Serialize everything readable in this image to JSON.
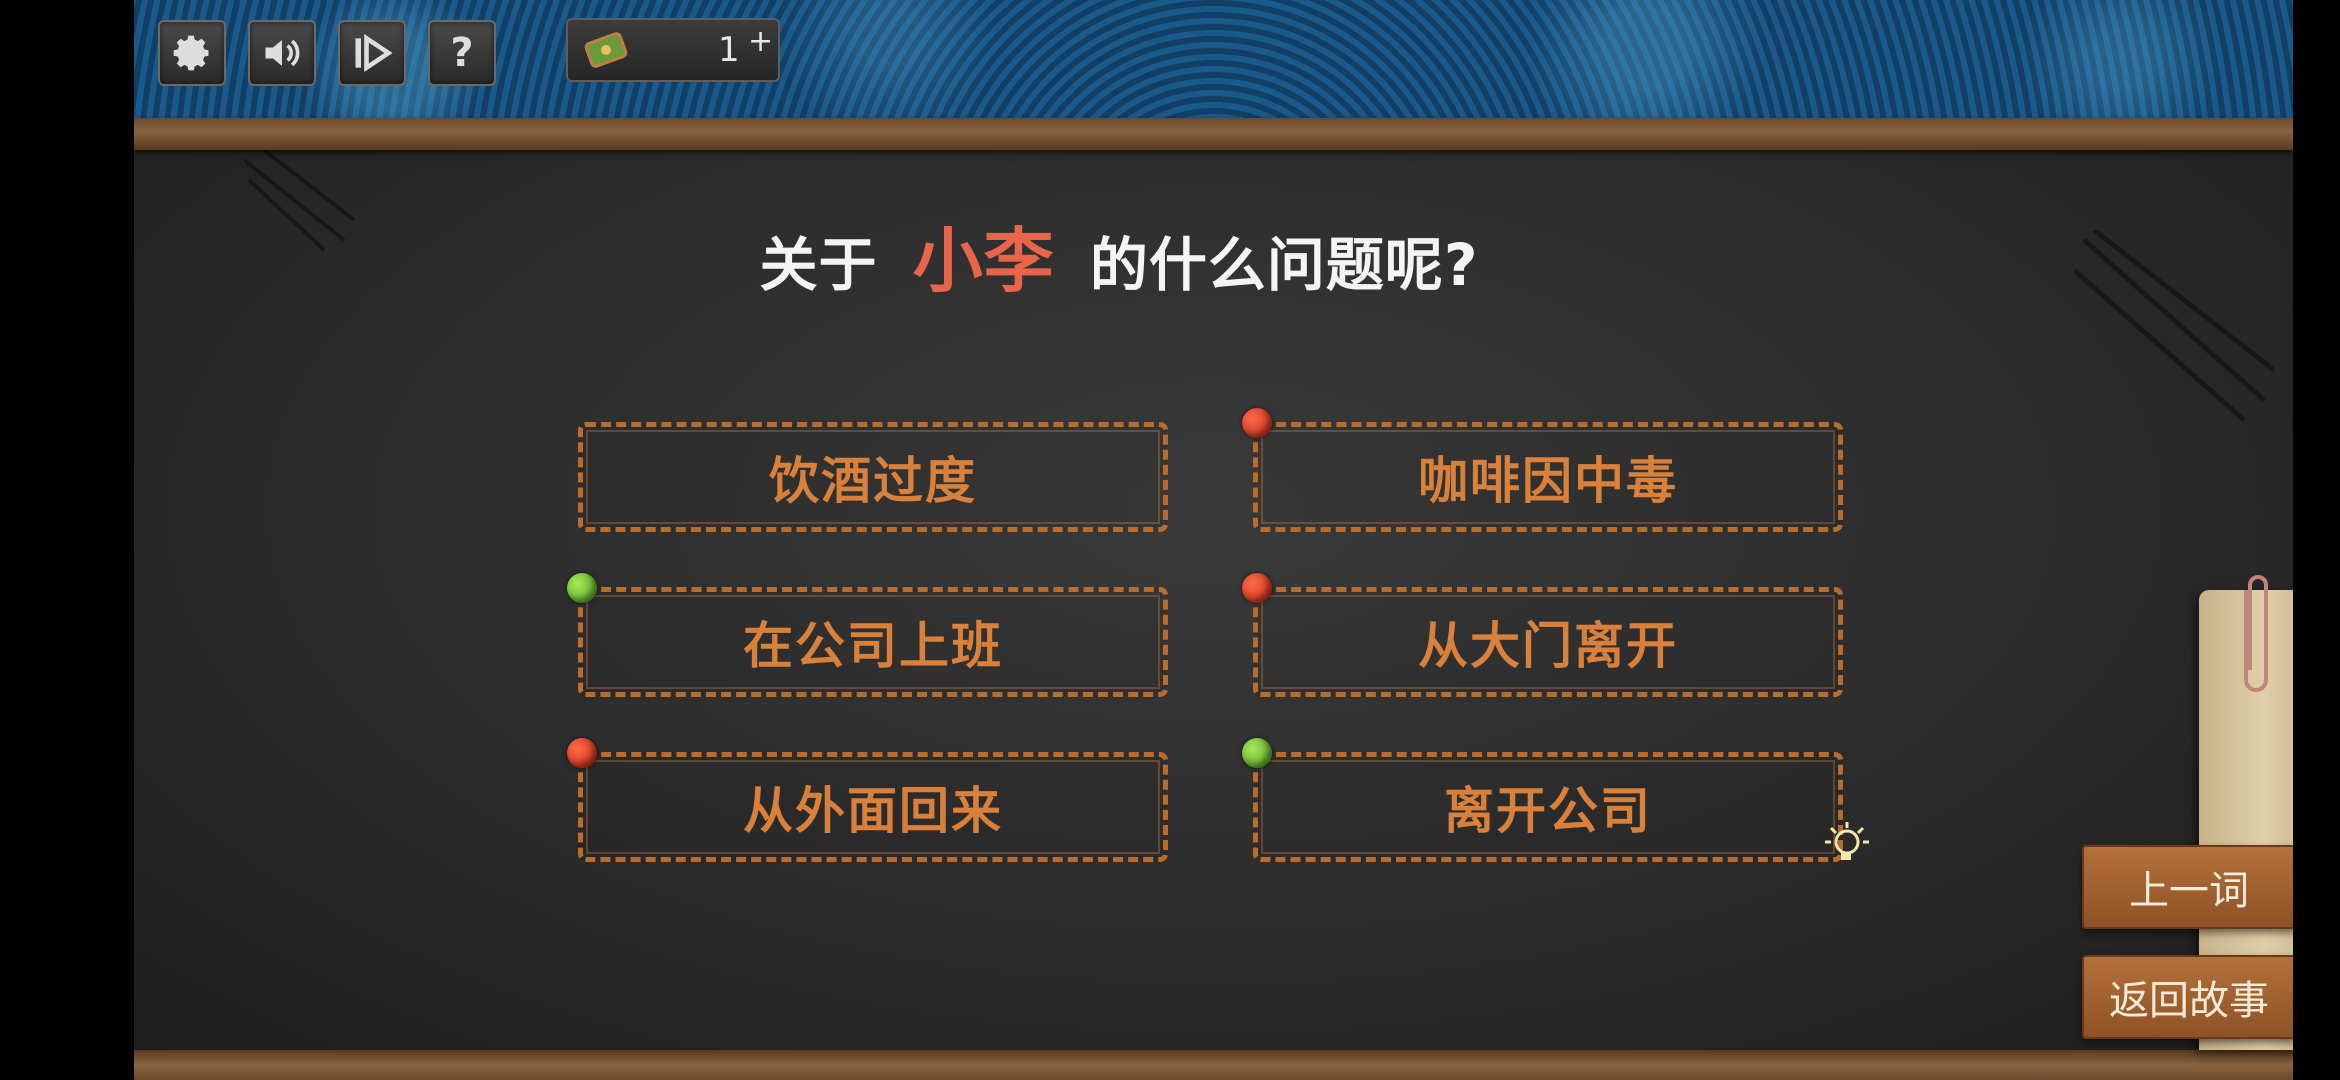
{
  "toolbar": {
    "settings_icon": "gear-icon",
    "sound_icon": "speaker-icon",
    "skip_icon": "skip-play-icon",
    "help_label": "?",
    "hint_count": "1",
    "hint_plus": "+"
  },
  "question": {
    "prefix": "关于",
    "name": "小李",
    "suffix": "的什么问题呢?"
  },
  "options": [
    {
      "label": "饮酒过度",
      "marker": "none"
    },
    {
      "label": "咖啡因中毒",
      "marker": "red"
    },
    {
      "label": "在公司上班",
      "marker": "green"
    },
    {
      "label": "从大门离开",
      "marker": "red"
    },
    {
      "label": "从外面回来",
      "marker": "red"
    },
    {
      "label": "离开公司",
      "marker": "green"
    }
  ],
  "side_buttons": {
    "previous": "上一词",
    "back_to_story": "返回故事"
  },
  "colors": {
    "name_highlight": "#e8654a",
    "option_text": "#d9813a",
    "dot_red": "#d83a1e",
    "dot_green": "#6cc030"
  }
}
